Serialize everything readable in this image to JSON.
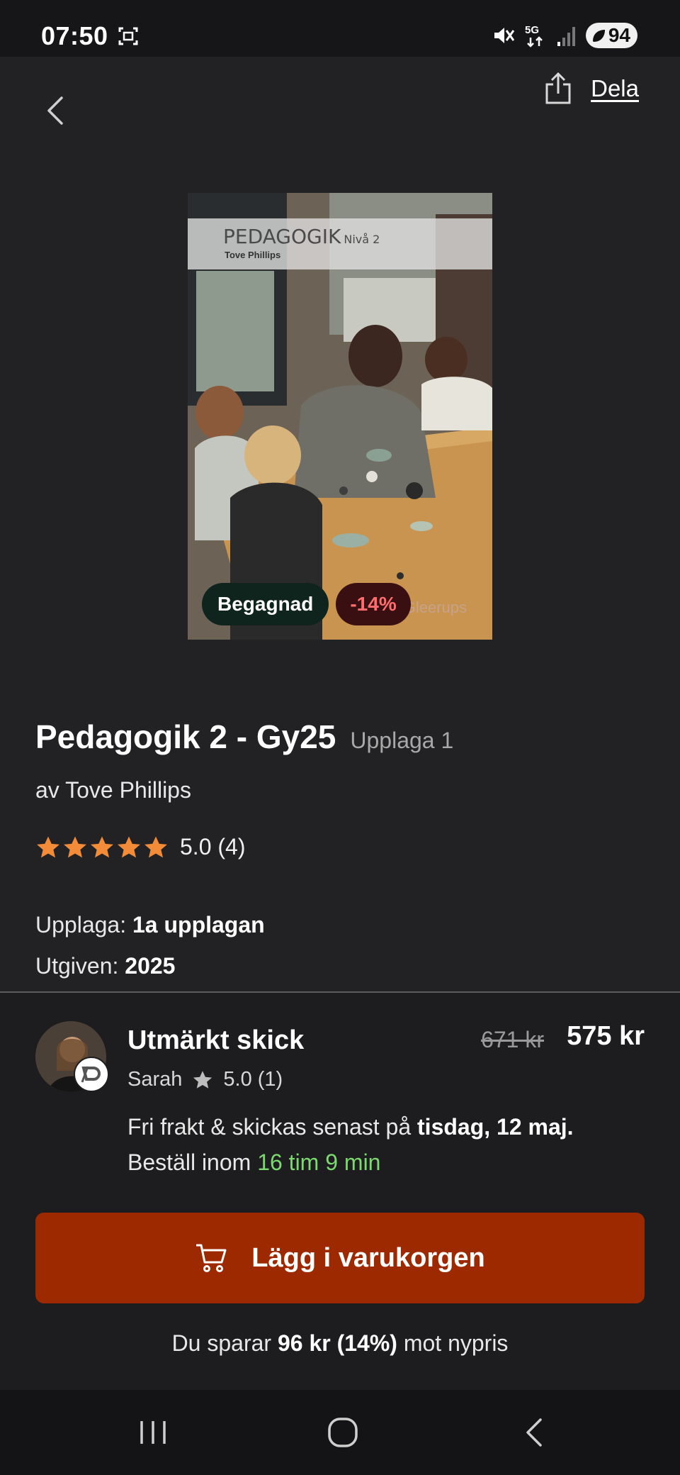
{
  "status_bar": {
    "time": "07:50",
    "network": "5G",
    "battery": "94",
    "icons": [
      "screenshot-icon",
      "mute-icon",
      "signal-icon",
      "battery-icon"
    ]
  },
  "top_bar": {
    "share_label": "Dela",
    "icons": [
      "back-arrow-icon",
      "share-icon"
    ]
  },
  "cover": {
    "title": "PEDAGOGIK",
    "level": "Nivå 2",
    "author": "Tove Phillips",
    "publisher": "Gleerups",
    "badge_condition": "Begagnad",
    "badge_discount": "-14%"
  },
  "product": {
    "title": "Pedagogik 2 - Gy25",
    "edition_tag": "Upplaga 1",
    "author_line": "av Tove Phillips",
    "rating": {
      "stars": 5,
      "text": "5.0 (4)"
    },
    "edition_label": "Upplaga:",
    "edition_value": "1a upplagan",
    "published_label": "Utgiven:",
    "published_value": "2025"
  },
  "offer": {
    "condition": "Utmärkt skick",
    "seller_name": "Sarah",
    "seller_rating": "5.0 (1)",
    "old_price": "671 kr",
    "price": "575 kr",
    "shipping_prefix": "Fri frakt & skickas senast på",
    "shipping_date": "tisdag, 12 maj.",
    "order_prefix": "Beställ inom",
    "countdown": "16 tim 9 min",
    "cart_button": "Lägg i varukorgen",
    "savings_prefix": "Du sparar",
    "savings_amount": "96 kr (14%)",
    "savings_suffix": "mot nypris"
  },
  "colors": {
    "background": "#222224",
    "accent_button": "#9c2900",
    "discount_text": "#ff6e6e",
    "countdown_green": "#7bd96f",
    "star_orange": "#f28c38"
  },
  "nav_bar": {
    "icons": [
      "recent-apps-icon",
      "home-icon",
      "back-icon"
    ]
  }
}
